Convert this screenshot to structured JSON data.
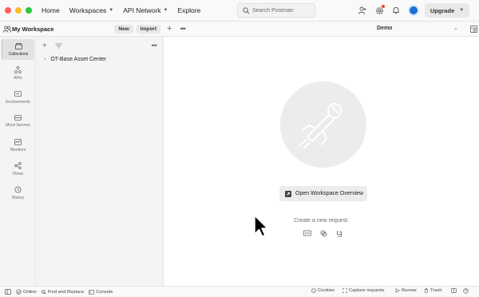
{
  "topbar": {
    "nav": {
      "home": "Home",
      "workspaces": "Workspaces",
      "api_network": "API Network",
      "explore": "Explore"
    },
    "search_placeholder": "Search Postman",
    "upgrade_label": "Upgrade"
  },
  "workspace": {
    "name": "My Workspace",
    "new_label": "New",
    "import_label": "Import"
  },
  "environment": {
    "selected": "Demo"
  },
  "rail": [
    {
      "label": "Collections",
      "icon": "collections-icon",
      "active": true
    },
    {
      "label": "APIs",
      "icon": "apis-icon"
    },
    {
      "label": "Environments",
      "icon": "environments-icon"
    },
    {
      "label": "Mock Servers",
      "icon": "mock-servers-icon"
    },
    {
      "label": "Monitors",
      "icon": "monitors-icon"
    },
    {
      "label": "Flows",
      "icon": "flows-icon"
    },
    {
      "label": "History",
      "icon": "history-icon"
    }
  ],
  "collections": [
    {
      "name": "OT-Base Asset Center"
    }
  ],
  "main": {
    "overview_button": "Open Workspace Overview",
    "new_request_label": "Create a new request:"
  },
  "statusbar": {
    "online": "Online",
    "find_replace": "Find and Replace",
    "console": "Console",
    "cookies": "Cookies",
    "capture": "Capture requests",
    "runner": "Runner",
    "trash": "Trash"
  },
  "colors": {
    "notification_dot": "#e5492f",
    "avatar": "#1a6fd6",
    "active_tab_accent": "#c0c0c0"
  }
}
